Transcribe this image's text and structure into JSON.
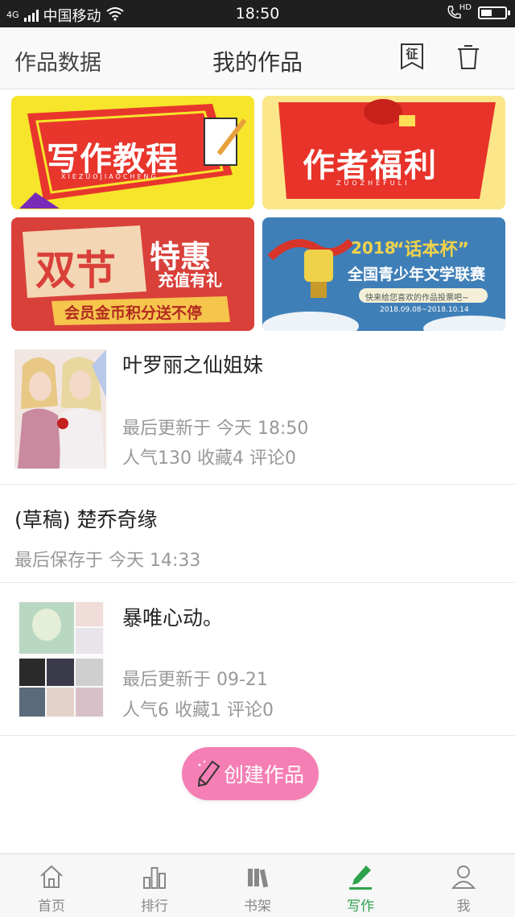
{
  "status_bar": {
    "network": "4G",
    "carrier": "中国移动",
    "time": "18:50",
    "call_indicator": "HD",
    "battery_level": 0.45
  },
  "header": {
    "left_link": "作品数据",
    "title": "我的作品",
    "stamp_icon_char": "征"
  },
  "banners": [
    {
      "title": "写作教程",
      "subtitle": "XIEZUOJIAOCHENG",
      "colors": [
        "#f6e52a",
        "#e8362d"
      ]
    },
    {
      "title": "作者福利",
      "subtitle": "ZUOZHEFULI",
      "colors": [
        "#fbe78a",
        "#e8332a"
      ]
    },
    {
      "title": "双节",
      "title2": "特惠",
      "tagline": "充值有礼",
      "ribbon": "会员金币积分送不停",
      "colors": [
        "#d9403a",
        "#f3d6b3"
      ]
    },
    {
      "year": "2018",
      "title": "“话本杯”",
      "subtitle": "全国青少年文学联赛",
      "ribbon": "快来给您喜欢的作品投票吧~",
      "dates": "2018.09.08~2018.10.14",
      "colors": [
        "#3f7fb8",
        "#f0d24a"
      ]
    }
  ],
  "works": [
    {
      "title": "叶罗丽之仙姐妹",
      "updated": "最后更新于 今天 18:50",
      "stats": "人气130 收藏4 评论0"
    },
    {
      "title": "(草稿) 楚乔奇缘",
      "updated": "最后保存于 今天 14:33"
    },
    {
      "title": "暴唯心动。",
      "updated": "最后更新于 09-21",
      "stats": "人气6 收藏1 评论0"
    }
  ],
  "create_button": {
    "label": "创建作品"
  },
  "tabs": [
    {
      "label": "首页",
      "icon": "home-icon"
    },
    {
      "label": "排行",
      "icon": "ranking-icon"
    },
    {
      "label": "书架",
      "icon": "bookshelf-icon"
    },
    {
      "label": "写作",
      "icon": "write-icon",
      "active": true
    },
    {
      "label": "我",
      "icon": "profile-icon"
    }
  ],
  "accent_color": "#2ea24b",
  "button_color": "#f57fb4"
}
